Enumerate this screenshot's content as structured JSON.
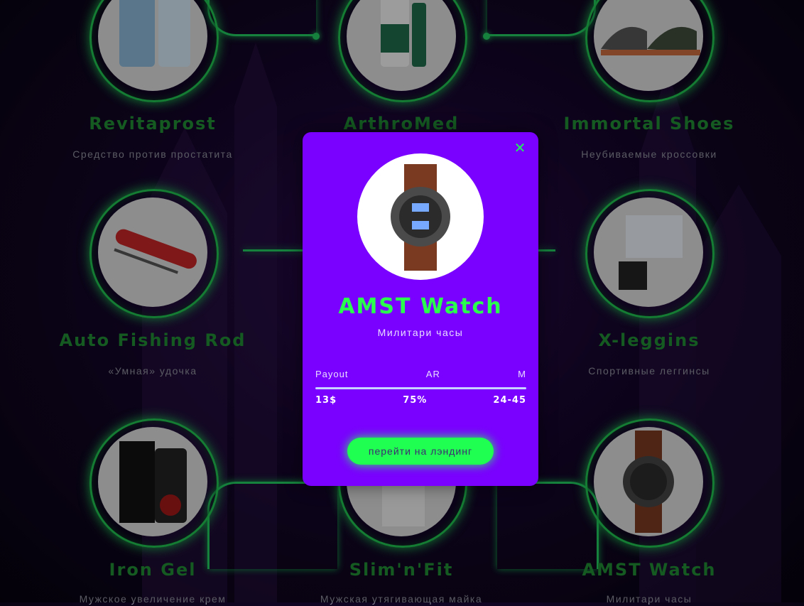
{
  "products": [
    {
      "title": "Revitaprost",
      "subtitle": "Средство против простатита",
      "image": "supplement-bottle-image"
    },
    {
      "title": "ArthroMed",
      "subtitle": "",
      "image": "spray-bottle-image"
    },
    {
      "title": "Immortal Shoes",
      "subtitle": "Неубиваемые кроссовки",
      "image": "sneakers-image"
    },
    {
      "title": "Auto Fishing Rod",
      "subtitle": "«Умная» удочка",
      "image": "fishing-rod-image"
    },
    {
      "title": "X-leggins",
      "subtitle": "Спортивные леггинсы",
      "image": "leggings-box-image"
    },
    {
      "title": "Iron Gel",
      "subtitle": "Мужское увеличение крем",
      "image": "gel-tube-image"
    },
    {
      "title": "Slim'n'Fit",
      "subtitle": "Мужская утягивающая майка",
      "image": "shirt-image"
    },
    {
      "title": "AMST Watch",
      "subtitle": "Милитари часы",
      "image": "watch-image"
    }
  ],
  "modal": {
    "title": "AMST Watch",
    "subtitle": "Милитари часы",
    "stats_headers": [
      "Payout",
      "AR",
      "M"
    ],
    "stats_values": [
      "13$",
      "75%",
      "24-45"
    ],
    "cta_label": "перейти на лэндинг",
    "close_icon": "close-icon"
  },
  "colors": {
    "accent_green": "#22c55e",
    "modal_bg": "#7a00ff",
    "title_green": "#1f8a34",
    "cta_green": "#1fff52"
  }
}
